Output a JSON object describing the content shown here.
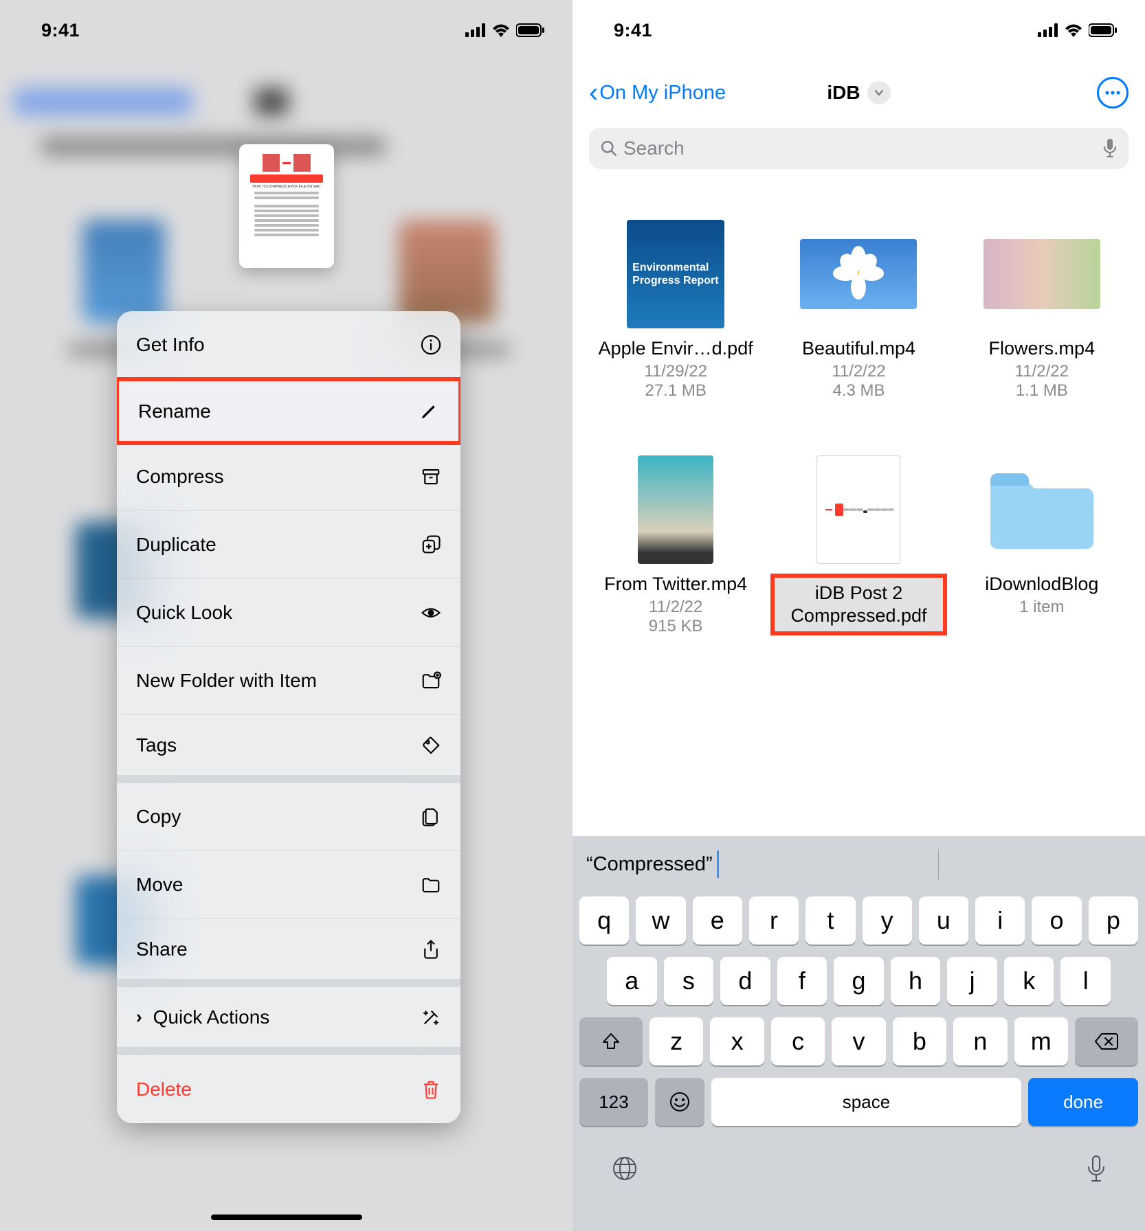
{
  "status": {
    "time": "9:41"
  },
  "preview_label": "HOW TO COMPRESS A PDF FILE ON MAC",
  "context_menu": {
    "items": [
      {
        "label": "Get Info",
        "icon": "info-icon"
      },
      {
        "label": "Rename",
        "icon": "pencil-icon",
        "highlight": true
      },
      {
        "label": "Compress",
        "icon": "archive-icon"
      },
      {
        "label": "Duplicate",
        "icon": "duplicate-icon"
      },
      {
        "label": "Quick Look",
        "icon": "eye-icon"
      },
      {
        "label": "New Folder with Item",
        "icon": "folder-plus-icon"
      },
      {
        "label": "Tags",
        "icon": "tag-icon"
      },
      {
        "label": "Copy",
        "icon": "copy-icon"
      },
      {
        "label": "Move",
        "icon": "folder-icon"
      },
      {
        "label": "Share",
        "icon": "share-icon"
      },
      {
        "label": "Quick Actions",
        "icon": "sparkle-icon",
        "chevron": true
      },
      {
        "label": "Delete",
        "icon": "trash-icon",
        "destructive": true
      }
    ]
  },
  "right": {
    "back_label": "On My iPhone",
    "title": "iDB",
    "search_placeholder": "Search",
    "files": [
      {
        "name": "Apple Envir…d.pdf",
        "date": "11/29/22",
        "size": "27.1 MB",
        "thumb": "env"
      },
      {
        "name": "Beautiful.mp4",
        "date": "11/2/22",
        "size": "4.3 MB",
        "thumb": "flower"
      },
      {
        "name": "Flowers.mp4",
        "date": "11/2/22",
        "size": "1.1 MB",
        "thumb": "pink"
      },
      {
        "name": "From Twitter.mp4",
        "date": "11/2/22",
        "size": "915 KB",
        "thumb": "beach"
      },
      {
        "name": "iDB Post 2 Compressed.pdf",
        "renaming": true,
        "thumb": "doc"
      },
      {
        "name": "iDownlodBlog",
        "meta": "1 item",
        "thumb": "folder"
      }
    ],
    "env_thumb_text": "Environmental Progress Report"
  },
  "keyboard": {
    "suggestion": "“Compressed”",
    "row1": [
      "q",
      "w",
      "e",
      "r",
      "t",
      "y",
      "u",
      "i",
      "o",
      "p"
    ],
    "row2": [
      "a",
      "s",
      "d",
      "f",
      "g",
      "h",
      "j",
      "k",
      "l"
    ],
    "row3": [
      "z",
      "x",
      "c",
      "v",
      "b",
      "n",
      "m"
    ],
    "key123": "123",
    "space": "space",
    "done": "done"
  }
}
